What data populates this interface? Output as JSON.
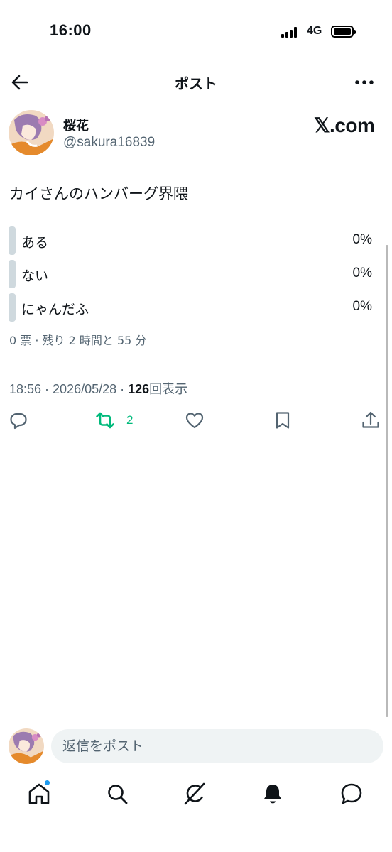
{
  "status_bar": {
    "time": "16:00",
    "network": "4G"
  },
  "header": {
    "title": "ポスト"
  },
  "author": {
    "display_name": "桜花",
    "handle": "@sakura16839",
    "brand": "𝕏.com"
  },
  "post": {
    "text": "カイさんのハンバーグ界隈",
    "poll": {
      "options": [
        {
          "label": "ある",
          "percent": "0%"
        },
        {
          "label": "ない",
          "percent": "0%"
        },
        {
          "label": "にゃんだふ",
          "percent": "0%"
        }
      ],
      "meta": "0 票 · 残り 2 時間と 55 分"
    },
    "time_date": "18:56 · 2026/05/28 · ",
    "views_count": "126",
    "views_label": "回表示"
  },
  "actions": {
    "retweet_count": "2"
  },
  "reply": {
    "placeholder": "返信をポスト"
  },
  "colors": {
    "accent_blue": "#1d9bf0",
    "retweet_green": "#00ba7c",
    "secondary_text": "#536471",
    "poll_bar": "#cfd9de"
  },
  "icons": [
    "back-arrow-icon",
    "more-icon",
    "reply-icon",
    "retweet-icon",
    "like-icon",
    "bookmark-icon",
    "share-icon",
    "home-icon",
    "search-icon",
    "grok-icon",
    "bell-icon",
    "messages-icon"
  ]
}
